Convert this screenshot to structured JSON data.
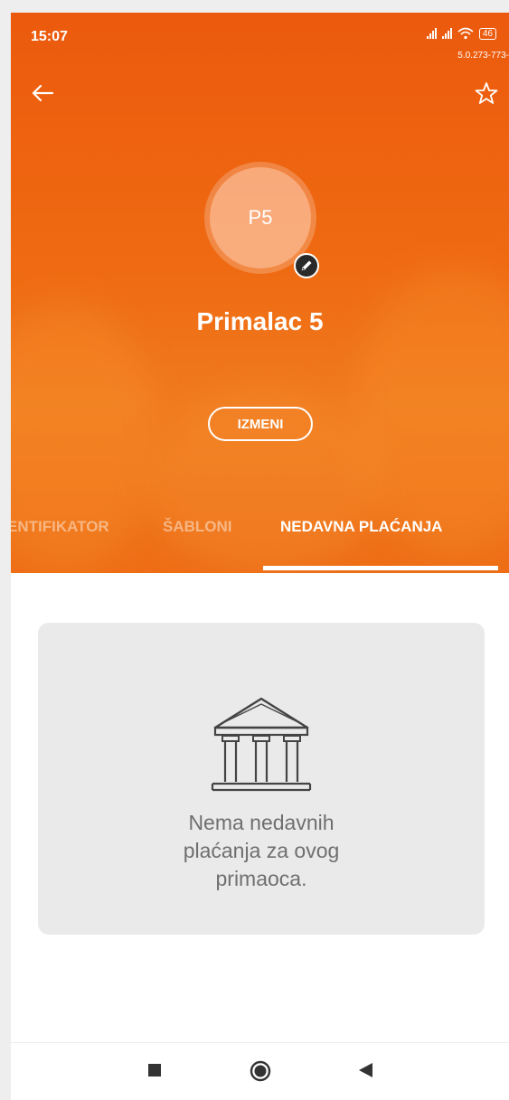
{
  "status_bar": {
    "time": "15:07",
    "battery": "46",
    "version": "5.0.273-773-"
  },
  "header": {
    "avatar_initials": "P5",
    "recipient_name": "Primalac 5",
    "edit_button_label": "IZMENI",
    "accent_color": "#ee6212"
  },
  "tabs": [
    {
      "label": "IDENTIFIKATOR",
      "visible_label": "ENTIFIKATOR",
      "active": false
    },
    {
      "label": "ŠABLONI",
      "active": false
    },
    {
      "label": "NEDAVNA PLAĆANJA",
      "active": true
    }
  ],
  "empty_state": {
    "icon": "bank-icon",
    "line1": "Nema nedavnih",
    "line2": "plaćanja za ovog",
    "line3": "primaoca."
  },
  "icons": {
    "back": "arrow-back-icon",
    "favorite": "star-outline-icon",
    "edit_avatar": "pencil-icon",
    "nav_recents": "square-icon",
    "nav_home": "circle-icon",
    "nav_back": "triangle-back-icon"
  }
}
